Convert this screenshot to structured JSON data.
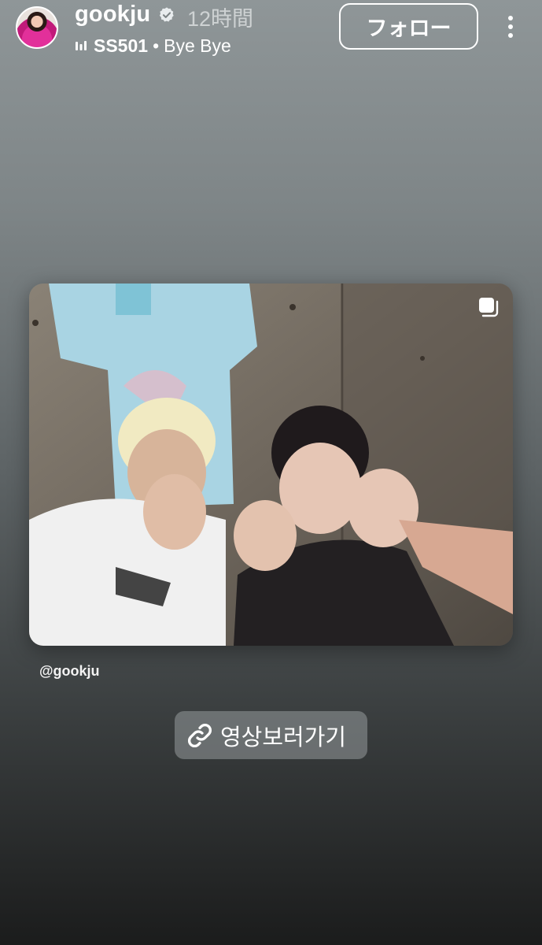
{
  "header": {
    "username": "gookju",
    "time": "12時間",
    "music_artist": "SS501",
    "music_separator": "•",
    "music_title": "Bye Bye",
    "follow_label": "フォロー"
  },
  "post": {
    "mention": "@gookju"
  },
  "link_sticker": {
    "label": "영상보러가기"
  },
  "icons": {
    "verified": "verified-badge-icon",
    "music": "audio-bars-icon",
    "more": "more-vertical-icon",
    "multi": "multiple-photos-icon",
    "link": "link-icon"
  },
  "colors": {
    "text": "#ffffff",
    "sticker_bg": "#8f9598"
  }
}
